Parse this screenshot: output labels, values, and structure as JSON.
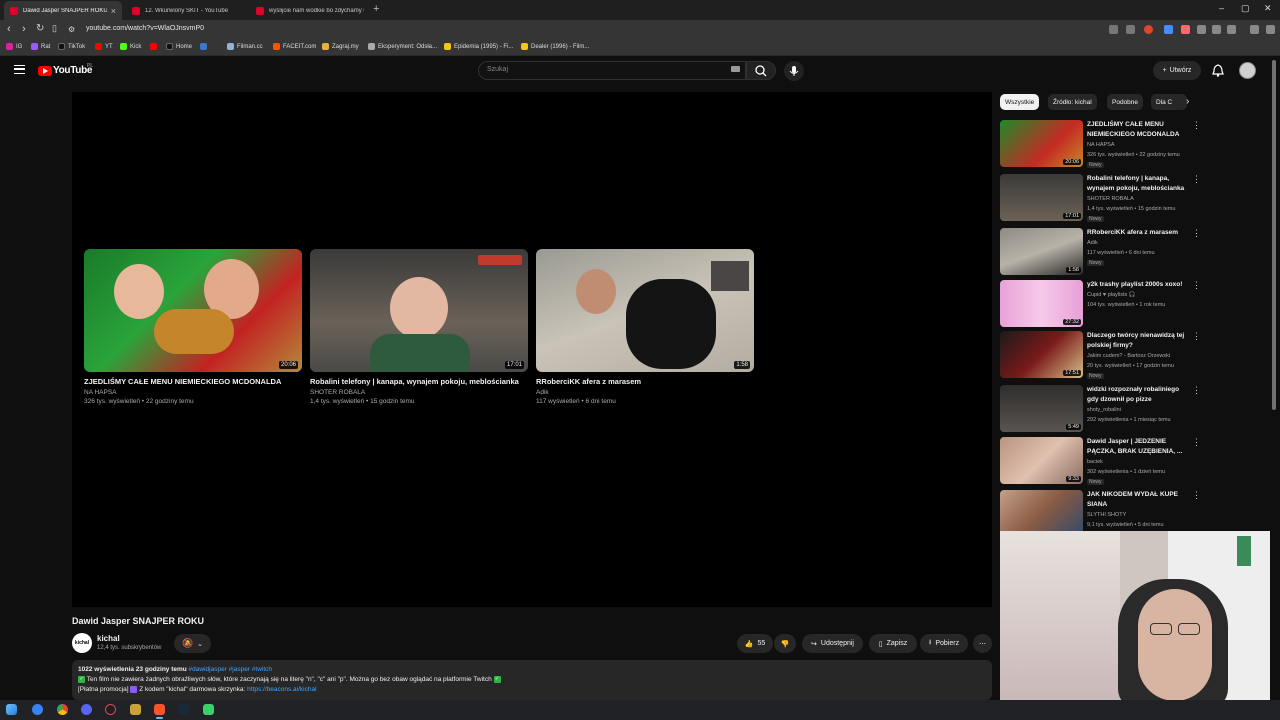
{
  "browser": {
    "tabs": [
      {
        "title": "Dawid Jasper SNAJPER ROKU -",
        "active": true
      },
      {
        "title": "12. Wkurwiony SKIT - YouTube",
        "active": false
      },
      {
        "title": "wyślijcie nam wodkie bo zdychamy n",
        "active": false
      }
    ],
    "url": "youtube.com/watch?v=WlaOJnsvmP0",
    "bookmarks": [
      "IG",
      "Rat",
      "TikTok",
      "YT",
      "Kick",
      "Home",
      "Filman.cc",
      "FACEIT.com",
      "Zagraj.my",
      "Eksperyment: Odsła...",
      "Epidemia (1995) - Fi...",
      "Dealer (1996) - Film..."
    ]
  },
  "header": {
    "logo_text": "YouTube",
    "logo_region": "PL",
    "search_placeholder": "Szukaj",
    "create_label": "Utwórz"
  },
  "endscreen": [
    {
      "title": "ZJEDLIŚMY CAŁE MENU NIEMIECKIEGO MCDONALDA",
      "channel": "NA HAPSA",
      "meta": "326 tys. wyświetleń • 22 godziny temu",
      "duration": "20:06"
    },
    {
      "title": "Robalini telefony | kanapa, wynajem pokoju, meblościanka",
      "channel": "SHOTER ROBALA",
      "meta": "1,4 tys. wyświetleń • 15 godzin temu",
      "duration": "17:01"
    },
    {
      "title": "RRoberciKK afera z marasem",
      "channel": "Adik",
      "meta": "117 wyświetleń • 6 dni temu",
      "duration": "1:58"
    }
  ],
  "video": {
    "title": "Dawid Jasper SNAJPER ROKU",
    "channel": "kichal",
    "channel_avatar_text": "kichal",
    "subscribers": "12,4 tys. subskrybentów",
    "likes": "55",
    "share_label": "Udostępnij",
    "save_label": "Zapisz",
    "download_label": "Pobierz",
    "desc_stats": "1022 wyświetlenia  23 godziny temu ",
    "desc_tags": "#dawidjasper #jasper #twitch",
    "desc_line1": "Ten film nie zawiera żadnych obraźliwych słów, które zaczynają się na literę \"n\", \"c\" ani \"p\". Można go bez obaw oglądać na platformie Twitch",
    "desc_line2_prefix": "[Płatna promocja]",
    "desc_line2_text": " Z kodem \"kichal\" darmowa skrzynka: ",
    "desc_link": "https://beacons.ai/kichal"
  },
  "chips": [
    "Wszystkie",
    "Źródło: kichal",
    "Podobne",
    "Dla C"
  ],
  "related": [
    {
      "title": "ZJEDLIŚMY CAŁE MENU NIEMIECKIEGO MCDONALDA",
      "channel": "NA HAPSA",
      "meta": "326 tys. wyświetleń • 22 godziny temu",
      "badge": "Nowy",
      "duration": "20:06"
    },
    {
      "title": "Robalini telefony | kanapa, wynajem pokoju, meblościanka",
      "channel": "SHOTER ROBALA",
      "meta": "1,4 tys. wyświetleń • 15 godzin temu",
      "badge": "Nowy",
      "duration": "17:01"
    },
    {
      "title": "RRoberciKK afera z marasem",
      "channel": "Adik",
      "meta": "117 wyświetleń • 6 dni temu",
      "badge": "Nowy",
      "duration": "1:58"
    },
    {
      "title": "y2k trashy playlist 2000s xoxo!",
      "channel": "Cupid ♥ playlists 🎧",
      "meta": "104 tys. wyświetleń • 1 rok temu",
      "badge": "",
      "duration": "27:32"
    },
    {
      "title": "Dlaczego twórcy nienawidzą tej polskiej firmy?",
      "channel": "Jakim cudem? - Bartosz Orzewski",
      "meta": "20 tys. wyświetleń • 17 godzin temu",
      "badge": "Nowy",
      "duration": "17:51"
    },
    {
      "title": "widzki rozpoznały robaliniego gdy dzownił po pizze",
      "channel": "shoty_robalini",
      "meta": "292 wyświetlenia • 1 miesiąc temu",
      "badge": "",
      "duration": "5:49"
    },
    {
      "title": "Dawid Jasper | JEDZENIE PĄCZKA, BRAK UZĘBIENIA, ...",
      "channel": "baciek",
      "meta": "302 wyświetlenia • 1 dzień temu",
      "badge": "Nowy",
      "duration": "9:33"
    },
    {
      "title": "JAK NIKODEM WYDAŁ KUPE SIANA",
      "channel": "SLYTHI SHOTY",
      "meta": "9,1 tys. wyświetleń • 5 dni temu",
      "badge": "",
      "duration": ""
    }
  ]
}
